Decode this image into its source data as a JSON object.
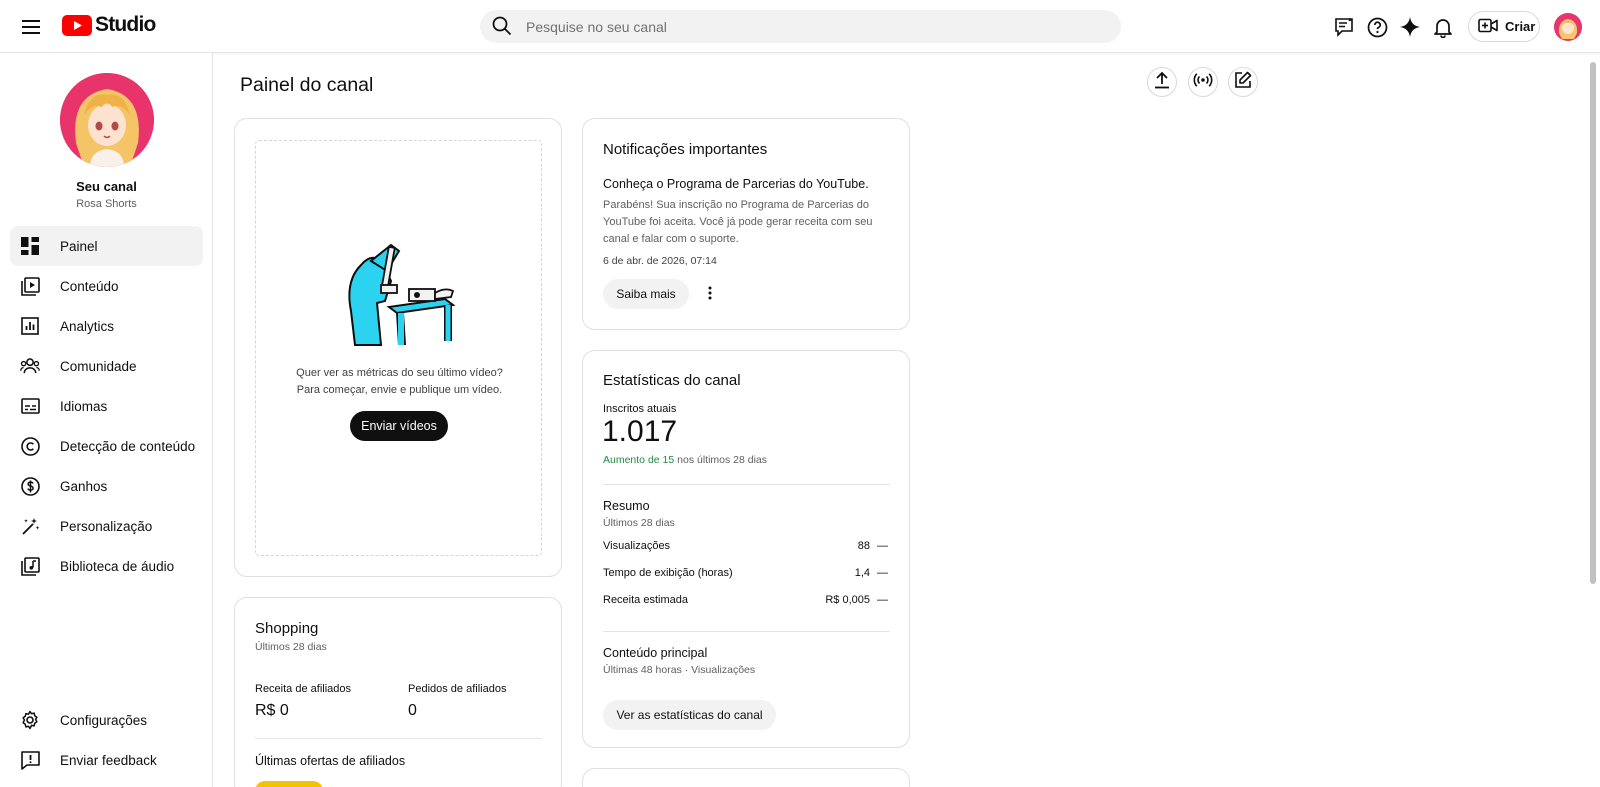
{
  "header": {
    "logo_text": "Studio",
    "search_placeholder": "Pesquise no seu canal",
    "create_label": "Criar"
  },
  "sidebar": {
    "channel_title": "Seu canal",
    "channel_handle": "Rosa Shorts",
    "items": [
      {
        "label": "Painel",
        "icon": "dashboard-icon",
        "active": true
      },
      {
        "label": "Conteúdo",
        "icon": "content-icon"
      },
      {
        "label": "Analytics",
        "icon": "analytics-icon"
      },
      {
        "label": "Comunidade",
        "icon": "community-icon"
      },
      {
        "label": "Idiomas",
        "icon": "subtitles-icon"
      },
      {
        "label": "Detecção de conteúdo",
        "icon": "copyright-icon"
      },
      {
        "label": "Ganhos",
        "icon": "earn-icon"
      },
      {
        "label": "Personalização",
        "icon": "magic-wand-icon"
      },
      {
        "label": "Biblioteca de áudio",
        "icon": "audio-library-icon"
      }
    ],
    "bottom_items": [
      {
        "label": "Configurações",
        "icon": "gear-icon"
      },
      {
        "label": "Enviar feedback",
        "icon": "feedback-icon"
      }
    ]
  },
  "main": {
    "page_title": "Painel do canal",
    "upload_card": {
      "line1": "Quer ver as métricas do seu último vídeo?",
      "line2": "Para começar, envie e publique um vídeo.",
      "button": "Enviar vídeos"
    },
    "notifications": {
      "title": "Notificações importantes",
      "subtitle": "Conheça o Programa de Parcerias do YouTube.",
      "body": "Parabéns! Sua inscrição no Programa de Parcerias do YouTube foi aceita. Você já pode gerar receita com seu canal e falar com o suporte.",
      "date": "6 de abr. de 2026, 07:14",
      "button": "Saiba mais"
    },
    "stats": {
      "title": "Estatísticas do canal",
      "subs_label": "Inscritos atuais",
      "subs_count": "1.017",
      "change_highlight": "Aumento de 15",
      "change_rest": " nos últimos 28 dias",
      "summary_title": "Resumo",
      "summary_sub": "Últimos 28 dias",
      "rows": [
        {
          "label": "Visualizações",
          "value": "88",
          "delta": "—"
        },
        {
          "label": "Tempo de exibição (horas)",
          "value": "1,4",
          "delta": "—"
        },
        {
          "label": "Receita estimada",
          "value": "R$ 0,005",
          "delta": "—"
        }
      ],
      "top_title": "Conteúdo principal",
      "top_sub": "Últimas 48 horas · Visualizações",
      "button": "Ver as estatísticas do canal"
    },
    "shopping": {
      "title": "Shopping",
      "sub": "Últimos 28 dias",
      "col1_label": "Receita de afiliados",
      "col1_value": "R$ 0",
      "col2_label": "Pedidos de afiliados",
      "col2_value": "0",
      "offers_title": "Últimas ofertas de afiliados"
    }
  },
  "colors": {
    "youtube_red": "#ff0000",
    "illustration_cyan": "#2bd3f0",
    "avatar_pink": "#e8336b",
    "increase_green": "#1e8e3e"
  }
}
